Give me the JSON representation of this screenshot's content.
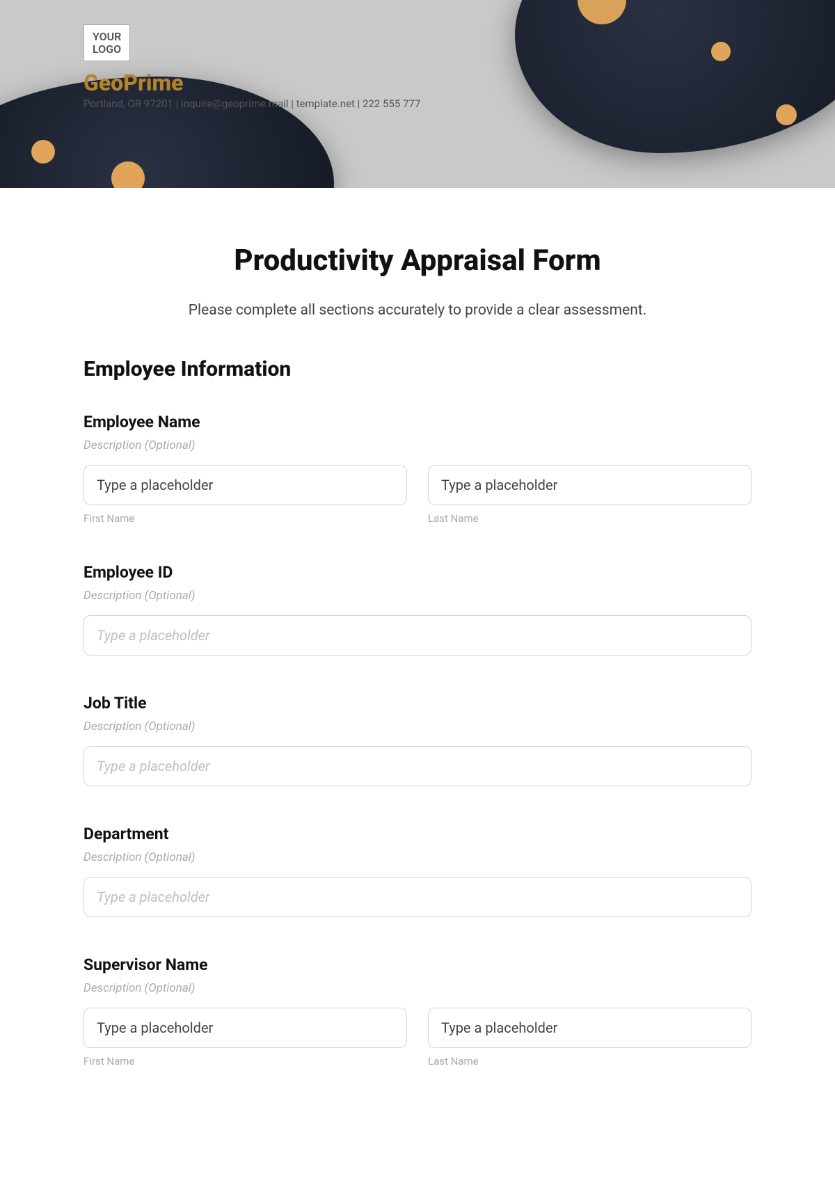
{
  "header": {
    "logo_text": "YOUR\nLOGO",
    "brand": "GeoPrime",
    "contact": "Portland, OR 97201 | inquire@geoprime.mail | template.net | 222 555 777"
  },
  "form": {
    "title": "Productivity Appraisal Form",
    "subtitle": "Please complete all sections accurately to provide a clear assessment.",
    "section_heading": "Employee Information",
    "desc_placeholder": "Description (Optional)",
    "labels": {
      "employee_name": "Employee Name",
      "employee_id": "Employee ID",
      "job_title": "Job Title",
      "department": "Department",
      "supervisor_name": "Supervisor Name",
      "first_name": "First Name",
      "last_name": "Last Name"
    },
    "placeholders": {
      "text": "Type a placeholder"
    }
  }
}
